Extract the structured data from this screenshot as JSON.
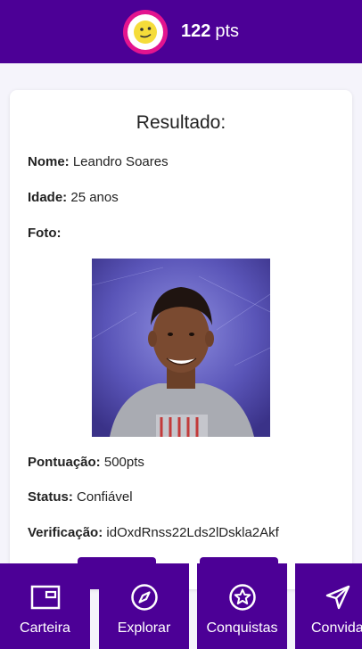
{
  "header": {
    "points_value": "122",
    "points_unit": "pts"
  },
  "result": {
    "title": "Resultado:",
    "name_label": "Nome:",
    "name_value": "Leandro Soares",
    "age_label": "Idade:",
    "age_value": "25 anos",
    "photo_label": "Foto:",
    "score_label": "Pontuação:",
    "score_value": "500pts",
    "status_label": "Status:",
    "status_value": "Confiável",
    "verification_label": "Verificação:",
    "verification_value": "idOxdRnss22Lds2lDskla2Akf"
  },
  "nav": {
    "items": [
      {
        "label": "Carteira",
        "icon": "wallet-icon"
      },
      {
        "label": "Explorar",
        "icon": "compass-icon"
      },
      {
        "label": "Conquistas",
        "icon": "star-badge-icon"
      },
      {
        "label": "Convidar",
        "icon": "send-icon"
      }
    ]
  },
  "colors": {
    "primary": "#4c0096",
    "accent": "#e3148f",
    "emoji": "#f5dc3a",
    "background": "#f5f4fb"
  }
}
